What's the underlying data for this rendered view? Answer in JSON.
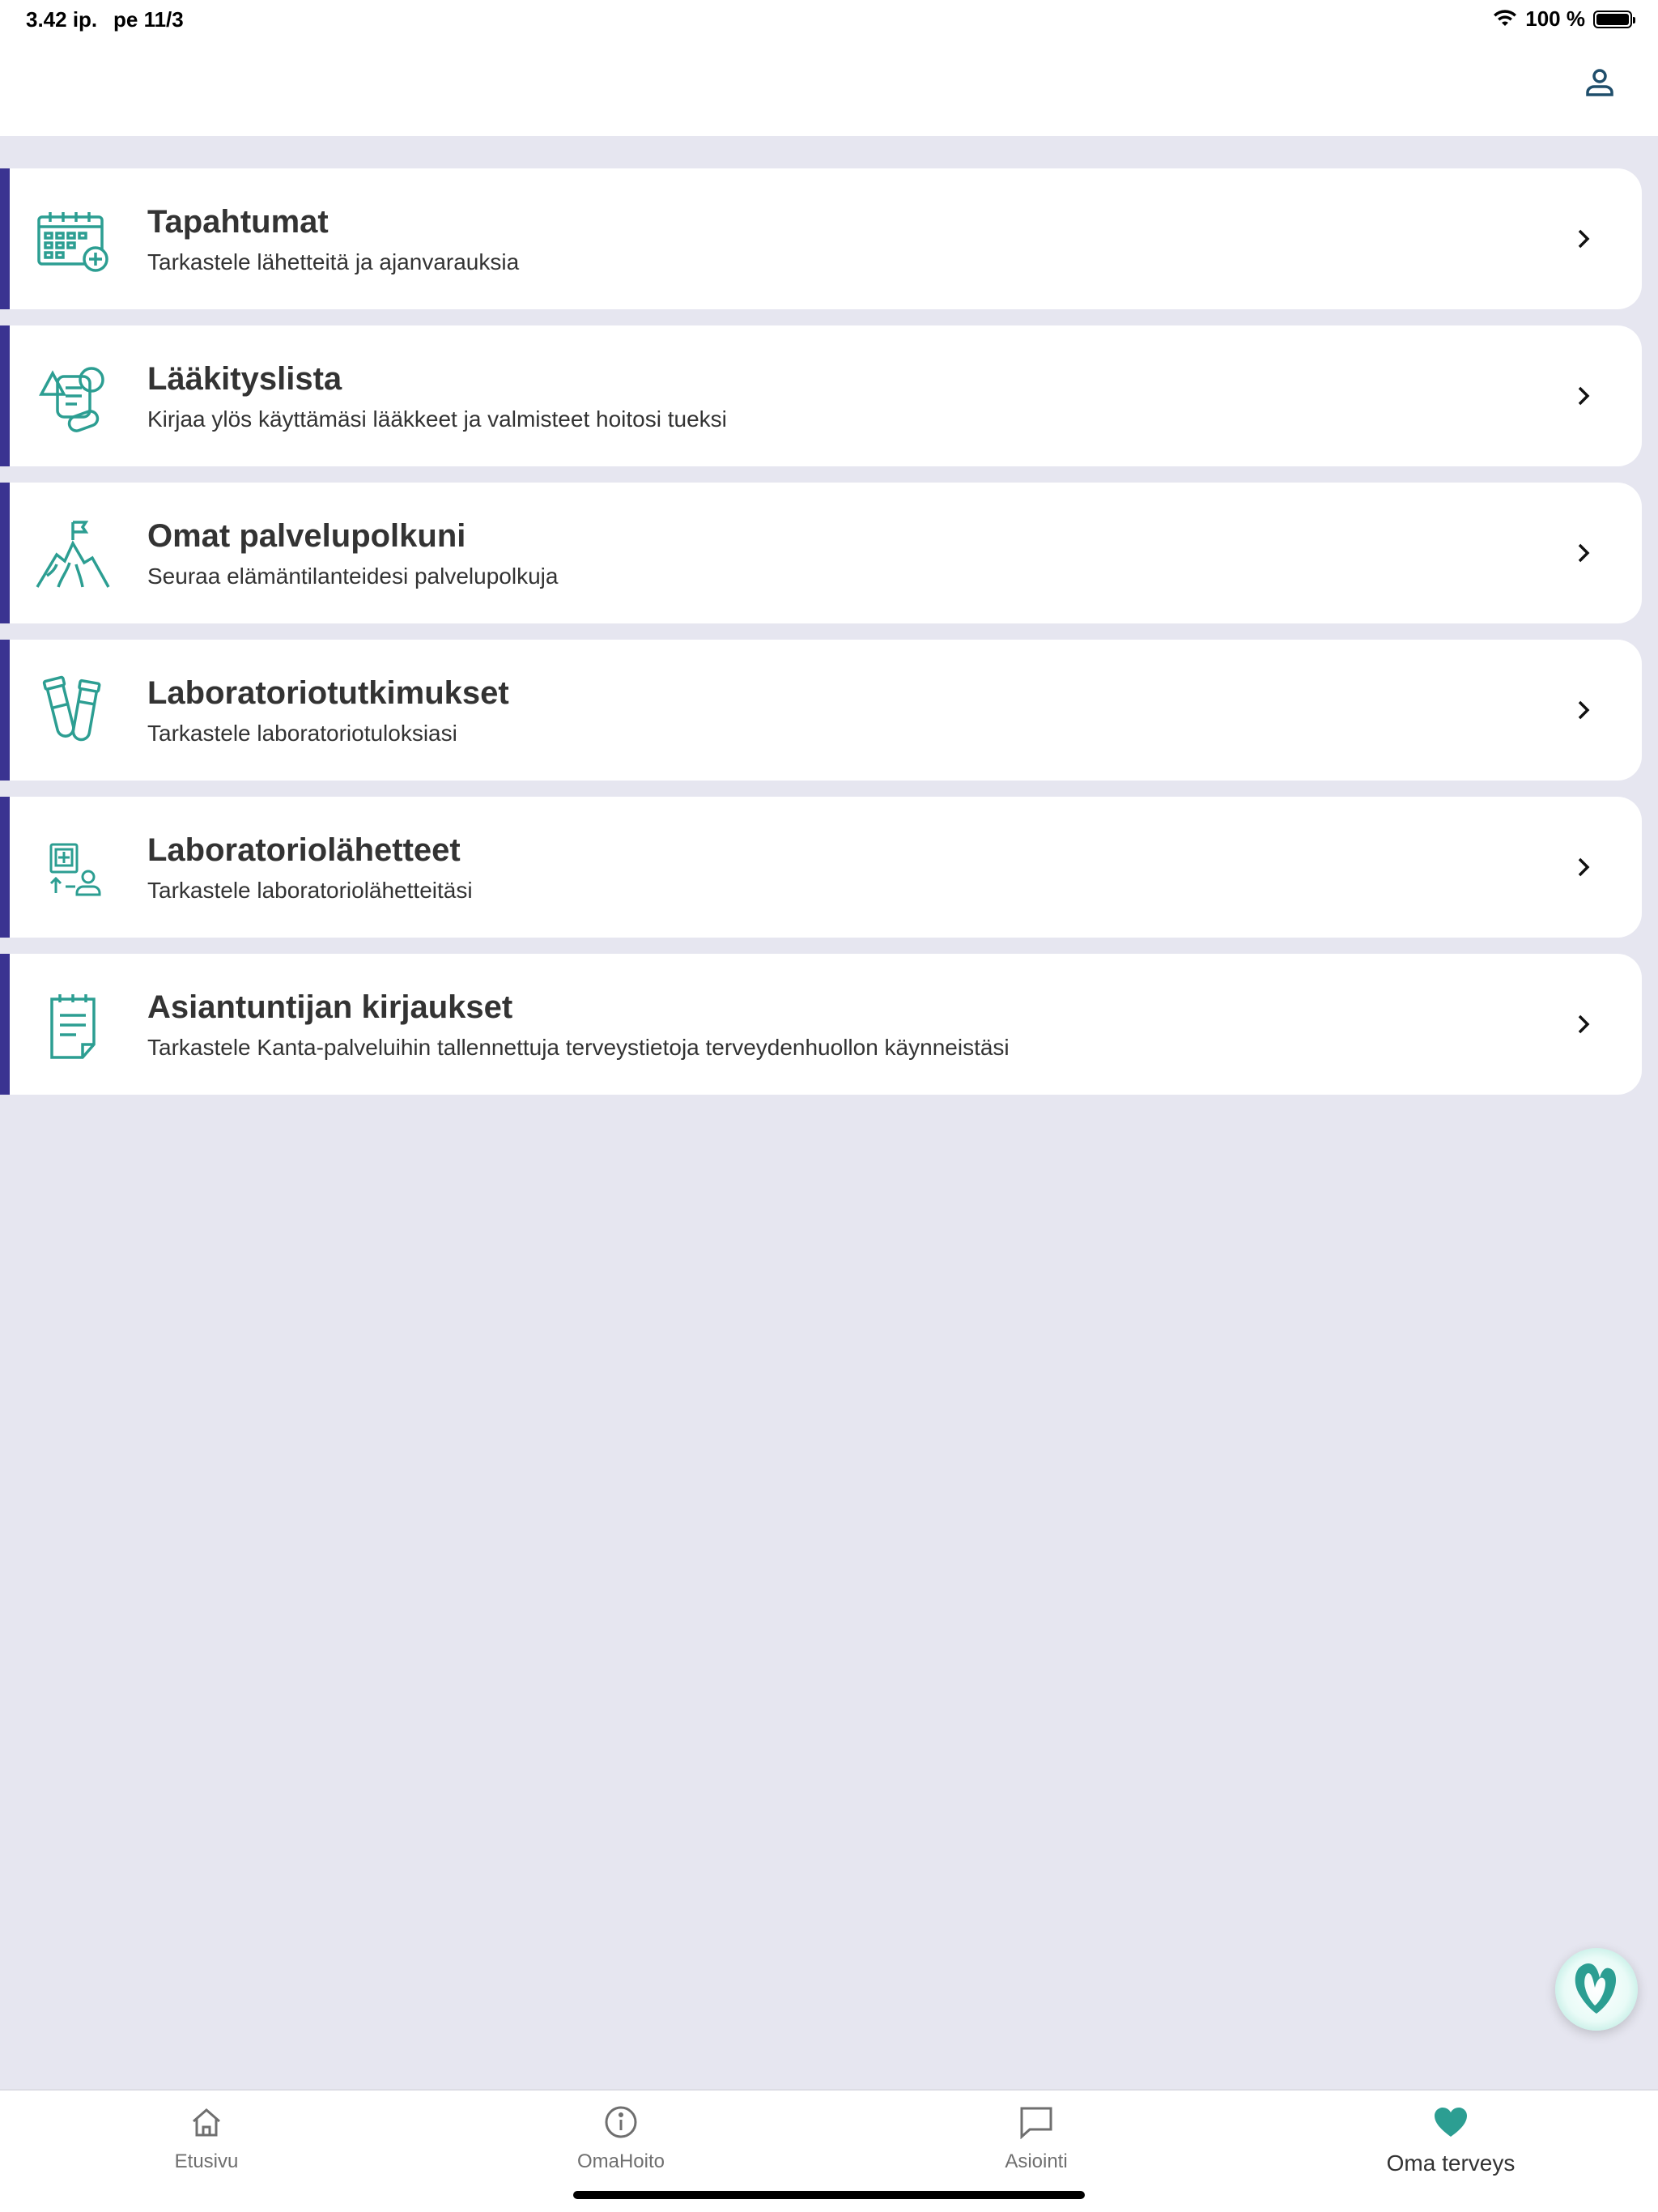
{
  "status_bar": {
    "time": "3.42 ip.",
    "date": "pe 11/3",
    "battery_text": "100 %"
  },
  "colors": {
    "accent_stripe": "#3a3391",
    "icon_teal": "#2c9e92",
    "background": "#e6e6f0"
  },
  "header": {
    "profile_icon": "person-icon"
  },
  "list": {
    "items": [
      {
        "title": "Tapahtumat",
        "subtitle": "Tarkastele lähetteitä ja ajanvarauksia",
        "icon": "calendar-add-icon"
      },
      {
        "title": "Lääkityslista",
        "subtitle": "Kirjaa ylös käyttämäsi lääkkeet ja valmisteet hoitosi tueksi",
        "icon": "medication-icon"
      },
      {
        "title": "Omat palvelupolkuni",
        "subtitle": "Seuraa elämäntilanteidesi palvelupolkuja",
        "icon": "mountain-flag-icon"
      },
      {
        "title": "Laboratoriotutkimukset",
        "subtitle": "Tarkastele laboratoriotuloksiasi",
        "icon": "test-tubes-icon"
      },
      {
        "title": "Laboratoriolähetteet",
        "subtitle": "Tarkastele laboratoriolähetteitäsi",
        "icon": "clinic-referral-icon"
      },
      {
        "title": "Asiantuntijan kirjaukset",
        "subtitle": "Tarkastele Kanta-palveluihin tallennettuja terveystietoja terveydenhuollon käynneistäsi",
        "icon": "notepad-icon"
      }
    ]
  },
  "fab": {
    "icon": "heart-chat-icon"
  },
  "tabs": [
    {
      "label": "Etusivu",
      "icon": "home-icon",
      "active": false
    },
    {
      "label": "OmaHoito",
      "icon": "info-icon",
      "active": false
    },
    {
      "label": "Asiointi",
      "icon": "chat-icon",
      "active": false
    },
    {
      "label": "Oma terveys",
      "icon": "heart-icon",
      "active": true
    }
  ]
}
